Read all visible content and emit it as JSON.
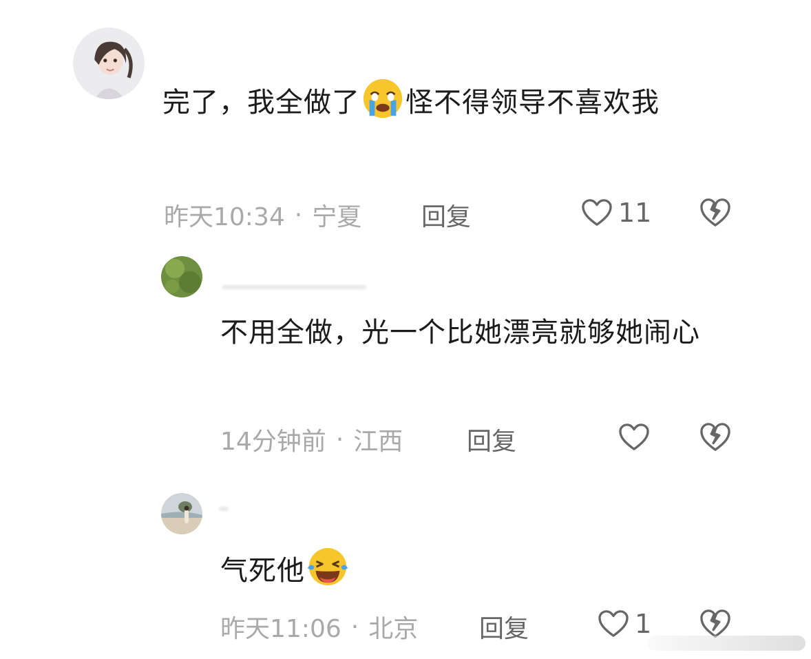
{
  "comments": [
    {
      "text": "完了，我全做了",
      "text_after_emoji": "怪不得领导不喜欢我",
      "emoji": "crying-face-emoji",
      "time": "昨天10:34",
      "separator": "·",
      "location": "宁夏",
      "reply_label": "回复",
      "like_count": "11"
    },
    {
      "text": "不用全做，光一个比她漂亮就够她闹心",
      "time": "14分钟前",
      "separator": "·",
      "location": "江西",
      "reply_label": "回复",
      "like_count": ""
    },
    {
      "text": "气死他",
      "emoji": "laughing-tears-emoji",
      "time": "昨天11:06",
      "separator": "·",
      "location": "北京",
      "reply_label": "回复",
      "like_count": "1"
    }
  ],
  "colors": {
    "text": "#1b1b1b",
    "meta": "#a9a9a9",
    "action": "#666666",
    "emoji_yellow": "#f7c52c",
    "emoji_tear": "#4aa3e6"
  }
}
